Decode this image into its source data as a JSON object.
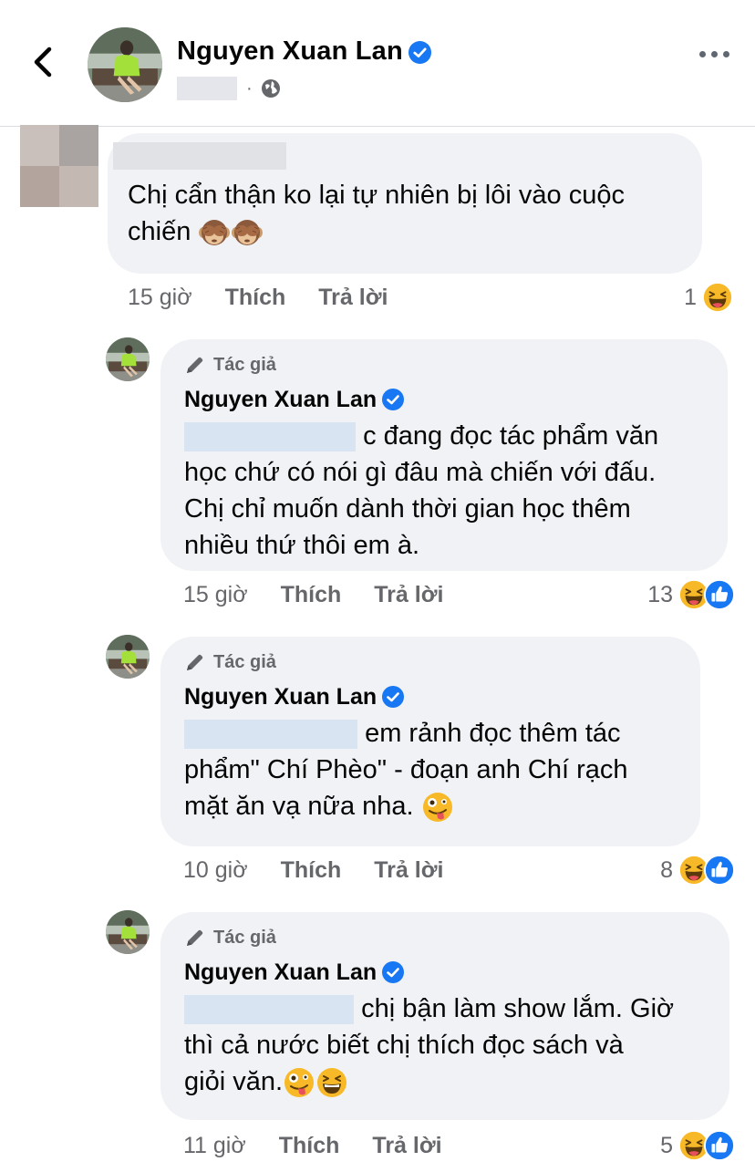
{
  "header": {
    "name": "Nguyen Xuan Lan"
  },
  "comments": [
    {
      "text_line1": "Chị cẩn thận ko lại tự nhiên bị lôi vào cuộc",
      "text_line2": "chiến",
      "time": "15 giờ",
      "like_label": "Thích",
      "reply_label": "Trả lời",
      "reaction_count": "1",
      "reactions": [
        "haha"
      ]
    },
    {
      "author_tag": "Tác giả",
      "name": "Nguyen Xuan Lan",
      "line1": "c đang đọc tác phẩm văn",
      "line2": "học chứ có nói gì đâu mà chiến với đấu.",
      "line3": "Chị chỉ muốn dành thời gian học thêm",
      "line4": "nhiều thứ thôi em à.",
      "time": "15 giờ",
      "like_label": "Thích",
      "reply_label": "Trả lời",
      "reaction_count": "13",
      "reactions": [
        "haha",
        "like"
      ]
    },
    {
      "author_tag": "Tác giả",
      "name": "Nguyen Xuan Lan",
      "line1": "em rảnh đọc thêm tác",
      "line2": "phẩm\" Chí Phèo\" - đoạn anh Chí rạch",
      "line3": "mặt ăn vạ nữa nha.",
      "time": "10 giờ",
      "like_label": "Thích",
      "reply_label": "Trả lời",
      "reaction_count": "8",
      "reactions": [
        "haha",
        "like"
      ]
    },
    {
      "author_tag": "Tác giả",
      "name": "Nguyen Xuan Lan",
      "line1": "chị bận làm show lắm. Giờ",
      "line2": "thì cả nước biết chị thích đọc sách và",
      "line3": "giỏi văn.",
      "time": "11 giờ",
      "like_label": "Thích",
      "reply_label": "Trả lời",
      "reaction_count": "5",
      "reactions": [
        "haha",
        "like"
      ]
    }
  ],
  "colors": {
    "verified": "#1877f2",
    "bubble": "#f0f2f5",
    "muted_text": "#65676b",
    "haha": "#f7b928",
    "like": "#1877f2"
  },
  "icons": [
    "back-chevron-icon",
    "verified-badge-icon",
    "globe-icon",
    "more-options-icon",
    "pencil-icon",
    "haha-reaction-icon",
    "like-reaction-icon",
    "see-no-evil-monkey-emoji",
    "zany-face-emoji",
    "grinning-squinting-emoji"
  ]
}
